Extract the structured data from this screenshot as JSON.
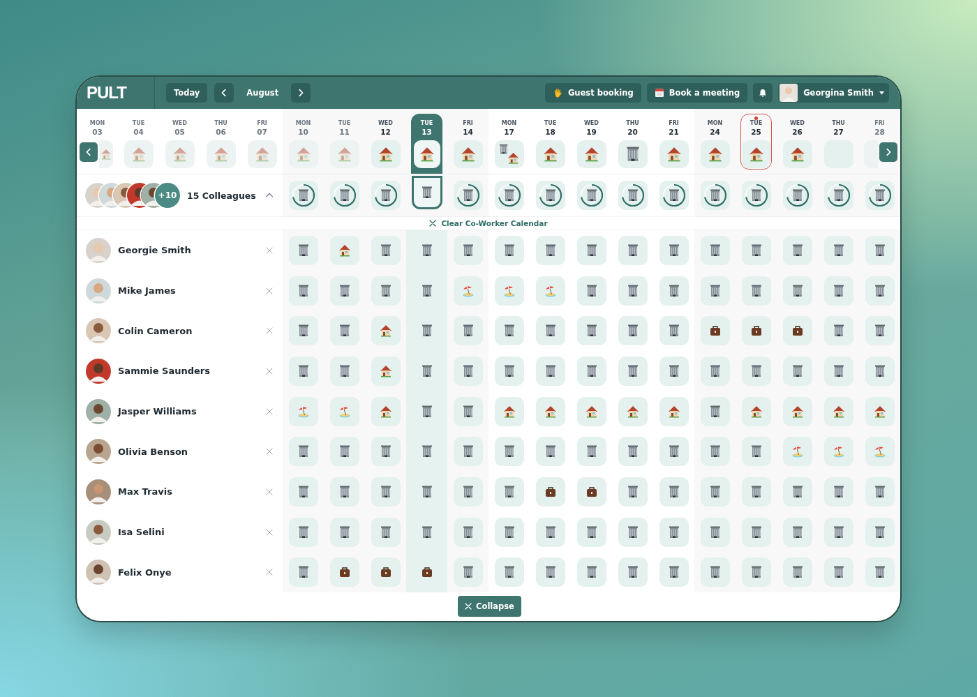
{
  "header": {
    "logo": "PULT",
    "today_button": "Today",
    "month": "August",
    "guest_booking": "Guest booking",
    "book_meeting": "Book a meeting",
    "user_name": "Georgina Smith"
  },
  "dates": [
    {
      "dow": "MON",
      "day": "03",
      "kind": "home",
      "faded": true,
      "selected": false,
      "today": false
    },
    {
      "dow": "TUE",
      "day": "04",
      "kind": "home",
      "faded": true,
      "selected": false,
      "today": false
    },
    {
      "dow": "WED",
      "day": "05",
      "kind": "home",
      "faded": true,
      "selected": false,
      "today": false
    },
    {
      "dow": "THU",
      "day": "06",
      "kind": "home",
      "faded": true,
      "selected": false,
      "today": false
    },
    {
      "dow": "FRI",
      "day": "07",
      "kind": "home",
      "faded": true,
      "selected": false,
      "today": false
    },
    {
      "dow": "MON",
      "day": "10",
      "kind": "home",
      "faded": true,
      "selected": false,
      "today": false
    },
    {
      "dow": "TUE",
      "day": "11",
      "kind": "home",
      "faded": true,
      "selected": false,
      "today": false
    },
    {
      "dow": "WED",
      "day": "12",
      "kind": "home",
      "faded": false,
      "selected": false,
      "today": false
    },
    {
      "dow": "TUE",
      "day": "13",
      "kind": "home",
      "faded": false,
      "selected": true,
      "today": false
    },
    {
      "dow": "FRI",
      "day": "14",
      "kind": "home",
      "faded": false,
      "selected": false,
      "today": false
    },
    {
      "dow": "MON",
      "day": "17",
      "kind": "mixed",
      "faded": false,
      "selected": false,
      "today": false
    },
    {
      "dow": "TUE",
      "day": "18",
      "kind": "home",
      "faded": false,
      "selected": false,
      "today": false
    },
    {
      "dow": "WED",
      "day": "19",
      "kind": "home",
      "faded": false,
      "selected": false,
      "today": false
    },
    {
      "dow": "THU",
      "day": "20",
      "kind": "building",
      "faded": false,
      "selected": false,
      "today": false
    },
    {
      "dow": "FRI",
      "day": "21",
      "kind": "home",
      "faded": false,
      "selected": false,
      "today": false
    },
    {
      "dow": "MON",
      "day": "24",
      "kind": "home",
      "faded": false,
      "selected": false,
      "today": false
    },
    {
      "dow": "TUE",
      "day": "25",
      "kind": "home",
      "faded": false,
      "selected": false,
      "today": true
    },
    {
      "dow": "WED",
      "day": "26",
      "kind": "home",
      "faded": false,
      "selected": false,
      "today": false
    },
    {
      "dow": "THU",
      "day": "27",
      "kind": "empty",
      "faded": false,
      "selected": false,
      "today": false
    },
    {
      "dow": "FRI",
      "day": "28",
      "kind": "empty",
      "faded": true,
      "selected": false,
      "today": false
    }
  ],
  "colleagues": {
    "label": "15 Colleagues",
    "more": "+10",
    "expanded": true,
    "occupancy": [
      {
        "selected": false
      },
      {
        "selected": false
      },
      {
        "selected": false
      },
      {
        "selected": true
      },
      {
        "selected": false
      },
      {
        "selected": false
      },
      {
        "selected": false
      },
      {
        "selected": false
      },
      {
        "selected": false
      },
      {
        "selected": false
      },
      {
        "selected": false
      },
      {
        "selected": false
      },
      {
        "selected": false
      },
      {
        "selected": false
      },
      {
        "selected": false
      }
    ]
  },
  "clear_link": "Clear Co-Worker Calendar",
  "people": [
    {
      "name": "Georgie Smith",
      "days": [
        {
          "kind": "building"
        },
        {
          "kind": "home"
        },
        {
          "kind": "building"
        },
        {
          "kind": "building"
        },
        {
          "kind": "building"
        },
        {
          "kind": "building"
        },
        {
          "kind": "building"
        },
        {
          "kind": "building"
        },
        {
          "kind": "building"
        },
        {
          "kind": "building"
        },
        {
          "kind": "building"
        },
        {
          "kind": "building"
        },
        {
          "kind": "building"
        },
        {
          "kind": "building"
        },
        {
          "kind": "building"
        }
      ]
    },
    {
      "name": "Mike James",
      "days": [
        {
          "kind": "building"
        },
        {
          "kind": "building"
        },
        {
          "kind": "building"
        },
        {
          "kind": "building"
        },
        {
          "kind": "beach"
        },
        {
          "kind": "beach"
        },
        {
          "kind": "beach"
        },
        {
          "kind": "building"
        },
        {
          "kind": "building"
        },
        {
          "kind": "building"
        },
        {
          "kind": "building"
        },
        {
          "kind": "building"
        },
        {
          "kind": "building"
        },
        {
          "kind": "building"
        },
        {
          "kind": "building"
        }
      ]
    },
    {
      "name": "Colin Cameron",
      "days": [
        {
          "kind": "building"
        },
        {
          "kind": "building"
        },
        {
          "kind": "home"
        },
        {
          "kind": "building"
        },
        {
          "kind": "building"
        },
        {
          "kind": "building"
        },
        {
          "kind": "building"
        },
        {
          "kind": "building"
        },
        {
          "kind": "building"
        },
        {
          "kind": "building"
        },
        {
          "kind": "case"
        },
        {
          "kind": "case"
        },
        {
          "kind": "case"
        },
        {
          "kind": "building"
        },
        {
          "kind": "building"
        }
      ]
    },
    {
      "name": "Sammie Saunders",
      "days": [
        {
          "kind": "building"
        },
        {
          "kind": "building"
        },
        {
          "kind": "home"
        },
        {
          "kind": "building"
        },
        {
          "kind": "building"
        },
        {
          "kind": "building"
        },
        {
          "kind": "building"
        },
        {
          "kind": "building"
        },
        {
          "kind": "building"
        },
        {
          "kind": "building"
        },
        {
          "kind": "building"
        },
        {
          "kind": "building"
        },
        {
          "kind": "building"
        },
        {
          "kind": "building"
        },
        {
          "kind": "building"
        }
      ]
    },
    {
      "name": "Jasper Williams",
      "days": [
        {
          "kind": "beach"
        },
        {
          "kind": "beach"
        },
        {
          "kind": "home"
        },
        {
          "kind": "building"
        },
        {
          "kind": "building"
        },
        {
          "kind": "home"
        },
        {
          "kind": "home"
        },
        {
          "kind": "home"
        },
        {
          "kind": "home"
        },
        {
          "kind": "home"
        },
        {
          "kind": "building"
        },
        {
          "kind": "home"
        },
        {
          "kind": "home"
        },
        {
          "kind": "home"
        },
        {
          "kind": "home"
        }
      ]
    },
    {
      "name": "Olivia Benson",
      "days": [
        {
          "kind": "building"
        },
        {
          "kind": "building"
        },
        {
          "kind": "building"
        },
        {
          "kind": "building"
        },
        {
          "kind": "building"
        },
        {
          "kind": "building"
        },
        {
          "kind": "building"
        },
        {
          "kind": "building"
        },
        {
          "kind": "building"
        },
        {
          "kind": "building"
        },
        {
          "kind": "building"
        },
        {
          "kind": "building"
        },
        {
          "kind": "beach"
        },
        {
          "kind": "beach"
        },
        {
          "kind": "beach"
        }
      ]
    },
    {
      "name": "Max Travis",
      "days": [
        {
          "kind": "building"
        },
        {
          "kind": "building"
        },
        {
          "kind": "building"
        },
        {
          "kind": "building"
        },
        {
          "kind": "building"
        },
        {
          "kind": "building"
        },
        {
          "kind": "case"
        },
        {
          "kind": "case"
        },
        {
          "kind": "building"
        },
        {
          "kind": "building"
        },
        {
          "kind": "building"
        },
        {
          "kind": "building"
        },
        {
          "kind": "building"
        },
        {
          "kind": "building"
        },
        {
          "kind": "building"
        }
      ]
    },
    {
      "name": "Isa Selini",
      "days": [
        {
          "kind": "building"
        },
        {
          "kind": "building"
        },
        {
          "kind": "building"
        },
        {
          "kind": "building"
        },
        {
          "kind": "building"
        },
        {
          "kind": "building"
        },
        {
          "kind": "building"
        },
        {
          "kind": "building"
        },
        {
          "kind": "building"
        },
        {
          "kind": "building"
        },
        {
          "kind": "building"
        },
        {
          "kind": "building"
        },
        {
          "kind": "building"
        },
        {
          "kind": "building"
        },
        {
          "kind": "building"
        }
      ]
    },
    {
      "name": "Felix Onye",
      "days": [
        {
          "kind": "building"
        },
        {
          "kind": "case"
        },
        {
          "kind": "case"
        },
        {
          "kind": "case"
        },
        {
          "kind": "building"
        },
        {
          "kind": "building"
        },
        {
          "kind": "building"
        },
        {
          "kind": "building"
        },
        {
          "kind": "building"
        },
        {
          "kind": "building"
        },
        {
          "kind": "building"
        },
        {
          "kind": "building"
        },
        {
          "kind": "building"
        },
        {
          "kind": "building"
        },
        {
          "kind": "building"
        }
      ]
    }
  ],
  "collapse_button": "Collapse"
}
